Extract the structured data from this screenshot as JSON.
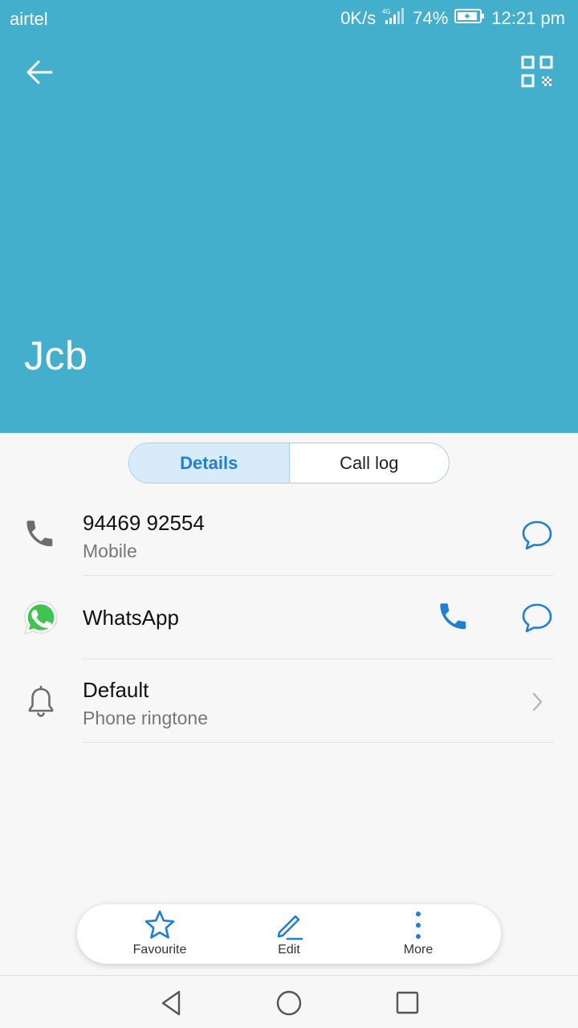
{
  "status_bar": {
    "carrier": "airtel",
    "speed": "0K/s",
    "network": "4G",
    "battery": "74%",
    "time": "12:21 pm"
  },
  "header": {
    "contact_name": "Jcb",
    "background_color": "#44afcd",
    "back_icon": "arrow-left-icon",
    "qr_icon": "qr-code-icon"
  },
  "tabs": [
    {
      "label": "Details",
      "active": true
    },
    {
      "label": "Call log",
      "active": false
    }
  ],
  "phone_row": {
    "number": "94469 92554",
    "type": "Mobile",
    "icon": "phone-icon",
    "action_icon": "message-icon"
  },
  "whatsapp_row": {
    "label": "WhatsApp",
    "icon": "whatsapp-icon",
    "call_icon": "phone-icon",
    "message_icon": "message-icon"
  },
  "ringtone_row": {
    "value": "Default",
    "label": "Phone ringtone",
    "icon": "bell-icon",
    "action_icon": "chevron-right-icon"
  },
  "bottom_actions": [
    {
      "label": "Favourite",
      "icon": "star-icon"
    },
    {
      "label": "Edit",
      "icon": "pencil-icon"
    },
    {
      "label": "More",
      "icon": "more-vertical-icon"
    }
  ],
  "accent_color": "#1f7fd6"
}
